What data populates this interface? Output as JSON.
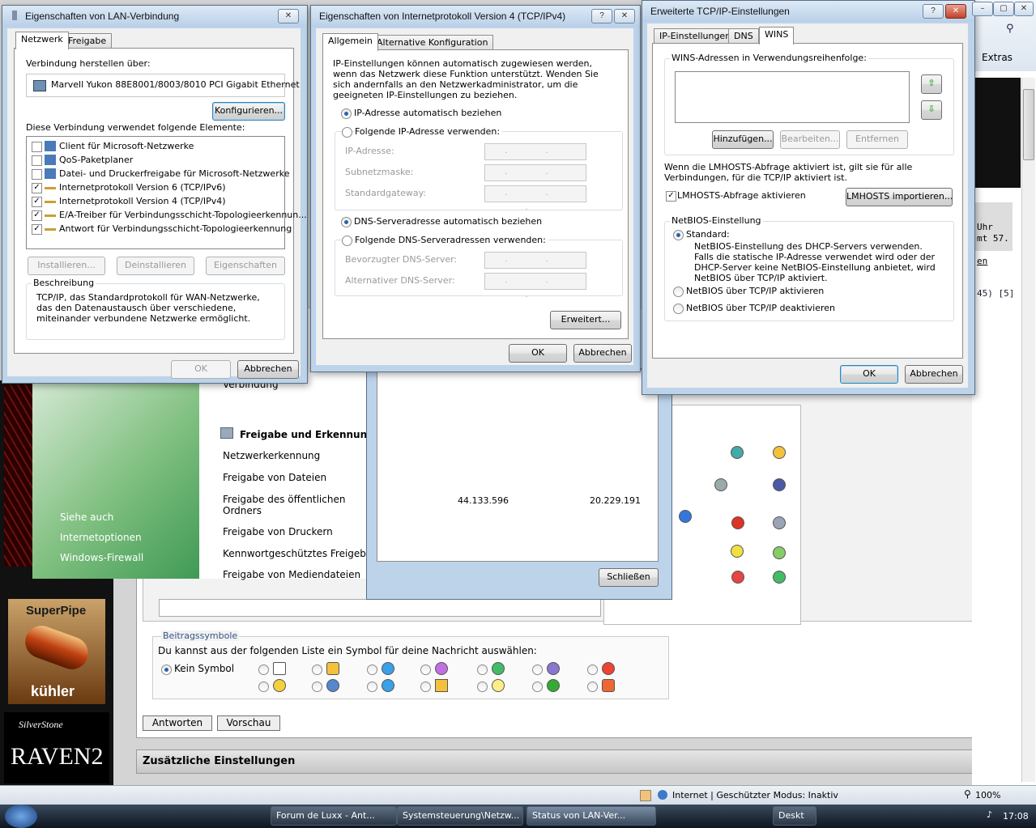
{
  "lan_dialog": {
    "title": "Eigenschaften von LAN-Verbindung",
    "tabs": [
      "Netzwerk",
      "Freigabe"
    ],
    "connect_via_label": "Verbindung herstellen über:",
    "adapter": "Marvell Yukon 88E8001/8003/8010 PCI Gigabit Ethernet",
    "configure_btn": "Konfigurieren...",
    "elements_label": "Diese Verbindung verwendet folgende Elemente:",
    "items": [
      {
        "label": "Client für Microsoft-Netzwerke",
        "checked": false
      },
      {
        "label": "QoS-Paketplaner",
        "checked": false
      },
      {
        "label": "Datei- und Druckerfreigabe für Microsoft-Netzwerke",
        "checked": false
      },
      {
        "label": "Internetprotokoll Version 6 (TCP/IPv6)",
        "checked": true
      },
      {
        "label": "Internetprotokoll Version 4 (TCP/IPv4)",
        "checked": true
      },
      {
        "label": "E/A-Treiber für Verbindungsschicht-Topologieerkennun...",
        "checked": true
      },
      {
        "label": "Antwort für Verbindungsschicht-Topologieerkennung",
        "checked": true
      }
    ],
    "install_btn": "Installieren...",
    "uninstall_btn": "Deinstallieren",
    "properties_btn": "Eigenschaften",
    "description_label": "Beschreibung",
    "description_text": "TCP/IP, das Standardprotokoll für WAN-Netzwerke, das den Datenaustausch über verschiedene, miteinander verbundene Netzwerke ermöglicht.",
    "ok_btn": "OK",
    "cancel_btn": "Abbrechen"
  },
  "ipv4_dialog": {
    "title": "Eigenschaften von Internetprotokoll Version 4 (TCP/IPv4)",
    "tabs": [
      "Allgemein",
      "Alternative Konfiguration"
    ],
    "intro": "IP-Einstellungen können automatisch zugewiesen werden, wenn das Netzwerk diese Funktion unterstützt. Wenden Sie sich andernfalls an den Netzwerkadministrator, um die geeigneten IP-Einstellungen zu beziehen.",
    "auto_ip": "IP-Adresse automatisch beziehen",
    "manual_ip": "Folgende IP-Adresse verwenden:",
    "ip_address": "IP-Adresse:",
    "subnet": "Subnetzmaske:",
    "gateway": "Standardgateway:",
    "auto_dns": "DNS-Serveradresse automatisch beziehen",
    "manual_dns": "Folgende DNS-Serveradressen verwenden:",
    "preferred_dns": "Bevorzugter DNS-Server:",
    "alternate_dns": "Alternativer DNS-Server:",
    "ip_placeholder": ". . .",
    "advanced_btn": "Erweitert...",
    "ok_btn": "OK",
    "cancel_btn": "Abbrechen"
  },
  "advanced_dialog": {
    "title": "Erweiterte TCP/IP-Einstellungen",
    "tabs": [
      "IP-Einstellungen",
      "DNS",
      "WINS"
    ],
    "wins_label": "WINS-Adressen in Verwendungsreihenfolge:",
    "add_btn": "Hinzufügen...",
    "edit_btn": "Bearbeiten...",
    "remove_btn": "Entfernen",
    "lmhosts_info": "Wenn die LMHOSTS-Abfrage aktiviert ist, gilt sie für alle Verbindungen, für die TCP/IP aktiviert ist.",
    "lmhosts_check": "LMHOSTS-Abfrage aktivieren",
    "lmhosts_import_btn": "LMHOSTS importieren...",
    "netbios_group": "NetBIOS-Einstellung",
    "netbios_standard": "Standard:",
    "netbios_standard_desc": "NetBIOS-Einstellung des DHCP-Servers verwenden. Falls die statische IP-Adresse verwendet wird oder der DHCP-Server keine NetBIOS-Einstellung anbietet, wird NetBIOS über TCP/IP aktiviert.",
    "netbios_enable": "NetBIOS über TCP/IP aktivieren",
    "netbios_disable": "NetBIOS über TCP/IP deaktivieren",
    "ok_btn": "OK",
    "cancel_btn": "Abbrechen"
  },
  "network_center": {
    "connection_text": "Verbindung",
    "section_title": "Freigabe und Erkennung",
    "items": [
      "Netzwerkerkennung",
      "Freigabe von Dateien",
      "Freigabe des öffentlichen Ordners",
      "Freigabe von Druckern",
      "Kennwortgeschütztes Freigeben",
      "Freigabe von Mediendateien"
    ],
    "see_also": "Siehe auch",
    "links": [
      "Internetoptionen",
      "Windows-Firewall"
    ]
  },
  "status_dialog": {
    "sent": "44.133.596",
    "received": "20.229.191",
    "close_btn": "Schließen"
  },
  "forum": {
    "symbols_legend": "Beitragssymbole",
    "symbols_prompt": "Du kannst aus der folgenden Liste ein Symbol für deine Nachricht auswählen:",
    "no_symbol": "Kein Symbol",
    "reply_btn": "Antworten",
    "preview_btn": "Vorschau",
    "extra_settings": "Zusätzliche Einstellungen",
    "side_text_1": "Uhr",
    "side_text_2": "mt 57.",
    "side_text_3": "en",
    "side_text_4": "45) [5]",
    "ad_superpipe": "SuperPipe",
    "ad_kuehler": "kühler",
    "ad_silverstone": "SilverStone",
    "ad_raven": "RAVEN2",
    "extras": "Extras"
  },
  "statusbar": {
    "zone": "Internet | Geschützter Modus: Inaktiv",
    "zoom": "100%"
  },
  "taskbar": {
    "items": [
      "Forum de Luxx - Ant...",
      "Systemsteuerung\\Netzw...",
      "Status von LAN-Ver..."
    ],
    "desk": "Deskt",
    "clock": "17:08"
  }
}
